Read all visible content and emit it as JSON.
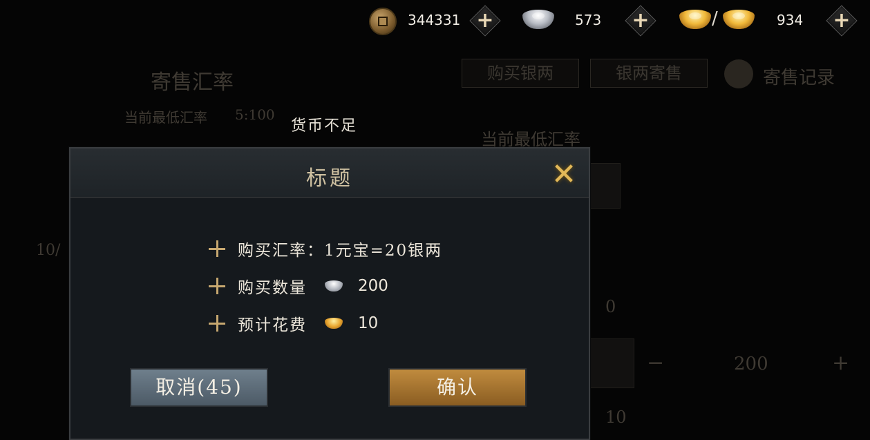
{
  "currencies": {
    "copper": {
      "icon": "copper-coin-icon",
      "value": "344331"
    },
    "silver": {
      "icon": "silver-ingot-icon",
      "value": "573"
    },
    "gold": {
      "icon": "gold-ingot-icon",
      "separator": "/",
      "value": "934"
    }
  },
  "background": {
    "section_title": "寄售汇率",
    "lowest_rate_label": "当前最低汇率",
    "lowest_rate_value": "5:100",
    "left_count": "10/",
    "tabs": [
      "购买银两",
      "银两寄售"
    ],
    "record_label": "寄售记录",
    "right_rate_label": "当前最低汇率",
    "right_value_1": "0",
    "stepper_value": "200",
    "right_value_2": "10"
  },
  "warning_text": "货币不足",
  "dialog": {
    "title": "标题",
    "rows": [
      {
        "label": "购买汇率：1元宝=20银两"
      },
      {
        "label": "购买数量",
        "icon": "silver-ingot-icon",
        "value": "200"
      },
      {
        "label": "预计花费",
        "icon": "gold-ingot-icon",
        "value": "10"
      }
    ],
    "cancel_label": "取消(45)",
    "confirm_label": "确认"
  },
  "colors": {
    "accent_gold": "#e2b858",
    "confirm_button": "#c08b3e",
    "cancel_button": "#6f7f8c"
  }
}
